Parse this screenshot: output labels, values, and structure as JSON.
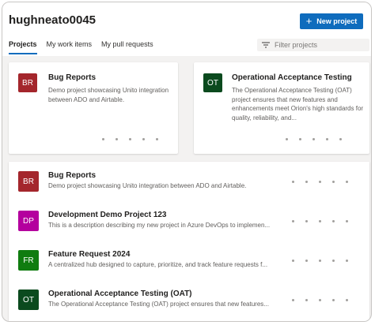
{
  "header": {
    "org_name": "hughneato0045",
    "new_project_label": "New project"
  },
  "tabs": [
    {
      "label": "Projects",
      "active": true
    },
    {
      "label": "My work items",
      "active": false
    },
    {
      "label": "My pull requests",
      "active": false
    }
  ],
  "filter": {
    "placeholder": "Filter projects"
  },
  "cards": [
    {
      "initials": "BR",
      "color": "#a4262c",
      "title": "Bug Reports",
      "description": "Demo project showcasing Unito integration between ADO and Airtable."
    },
    {
      "initials": "OT",
      "color": "#0b4a1e",
      "title": "Operational Acceptance Testing",
      "description": "The Operational Acceptance Testing (OAT) project ensures that new features and enhancements meet Orion's high standards for quality, reliability, and..."
    }
  ],
  "projects": [
    {
      "initials": "BR",
      "color": "#a4262c",
      "name": "Bug Reports",
      "description": "Demo project showcasing Unito integration between ADO and Airtable."
    },
    {
      "initials": "DP",
      "color": "#b4009e",
      "name": "Development Demo Project 123",
      "description": "This is a description describing my new project in Azure DevOps to implemen..."
    },
    {
      "initials": "FR",
      "color": "#107c10",
      "name": "Feature Request 2024",
      "description": "A centralized hub designed to capture, prioritize, and track feature requests f..."
    },
    {
      "initials": "OT",
      "color": "#0b4a1e",
      "name": "Operational Acceptance Testing (OAT)",
      "description": "The Operational Acceptance Testing (OAT) project ensures that new features..."
    }
  ]
}
